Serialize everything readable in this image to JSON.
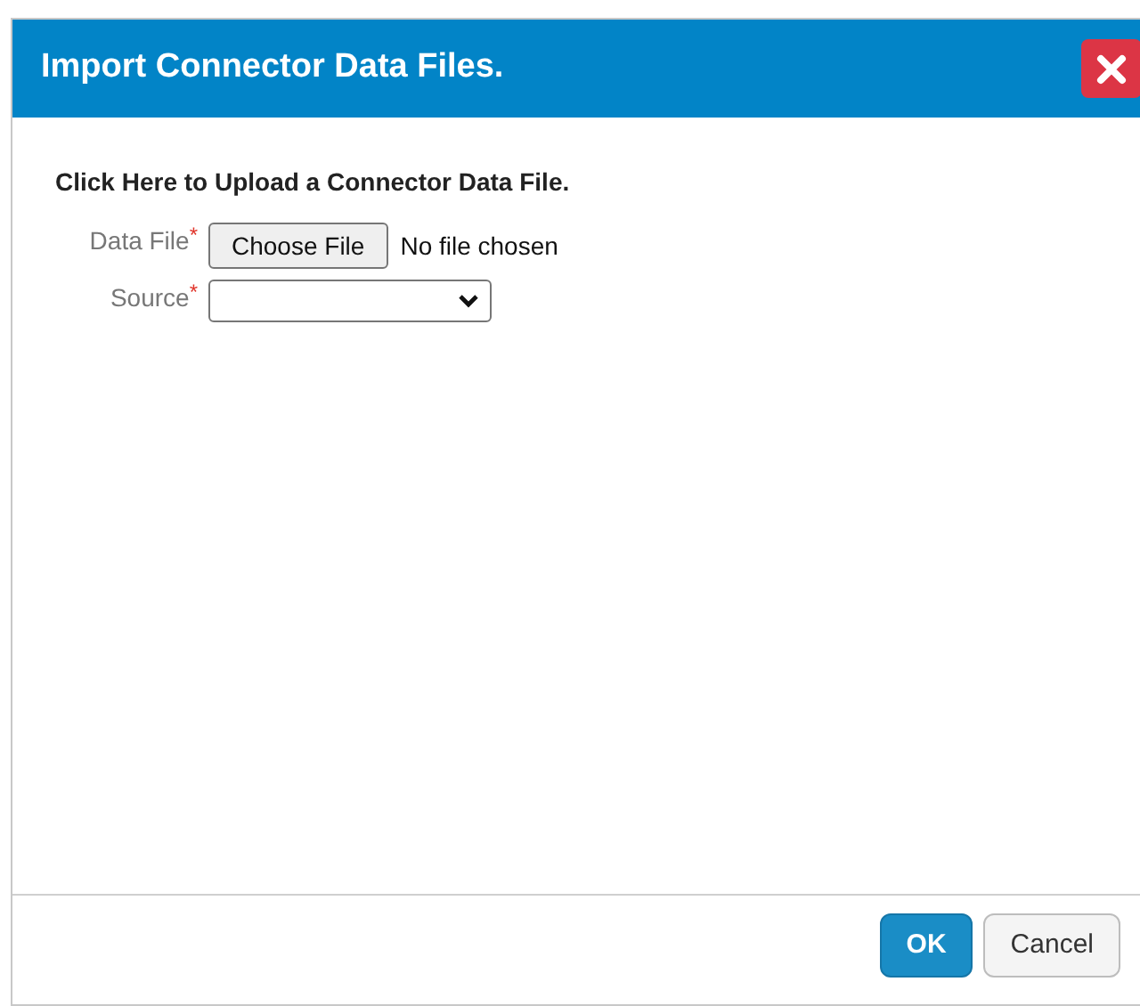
{
  "dialog": {
    "title": "Import Connector Data Files."
  },
  "instruction": "Click Here to Upload a Connector Data File.",
  "fields": [
    {
      "kind": "file",
      "label": "Data File",
      "required_mark": "*",
      "button": "Choose File",
      "value": "No file chosen"
    },
    {
      "kind": "select",
      "label": "Source",
      "required_mark": "*"
    }
  ],
  "buttons": [
    {
      "label": "OK",
      "kind": "primary"
    },
    {
      "label": "Cancel",
      "kind": "secondary"
    }
  ]
}
